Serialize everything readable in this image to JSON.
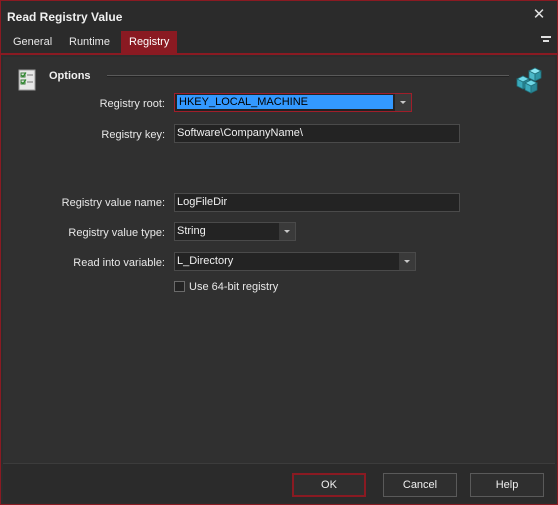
{
  "window": {
    "title": "Read Registry Value"
  },
  "tabs": [
    {
      "label": "General"
    },
    {
      "label": "Runtime"
    },
    {
      "label": "Registry"
    }
  ],
  "active_tab": "Registry",
  "options": {
    "section_label": "Options"
  },
  "form": {
    "registry_root": {
      "label": "Registry root:",
      "value": "HKEY_LOCAL_MACHINE"
    },
    "registry_key": {
      "label": "Registry key:",
      "value": "Software\\CompanyName\\"
    },
    "value_name": {
      "label": "Registry value name:",
      "value": "LogFileDir"
    },
    "value_type": {
      "label": "Registry value type:",
      "value": "String"
    },
    "read_into": {
      "label": "Read into variable:",
      "value": "L_Directory"
    },
    "use_64bit": {
      "label": "Use 64-bit registry",
      "checked": false
    }
  },
  "buttons": {
    "ok": "OK",
    "cancel": "Cancel",
    "help": "Help"
  },
  "colors": {
    "accent": "#8a1a22",
    "selection": "#3399ff",
    "background": "#2d2d2d"
  },
  "icons": {
    "options": "checklist-icon",
    "registry": "registry-cubes-icon",
    "close": "close-icon",
    "tab_menu": "menu-icon"
  }
}
